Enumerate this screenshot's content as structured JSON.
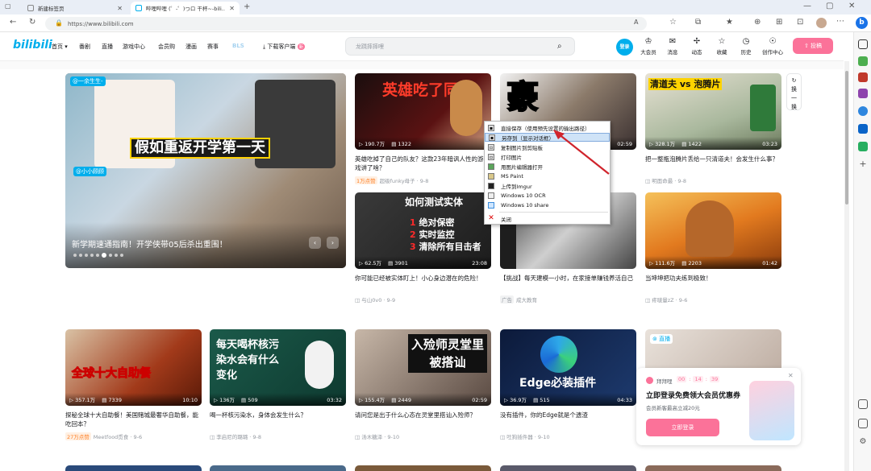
{
  "browser": {
    "tabs": [
      {
        "label": "新建标签页"
      },
      {
        "label": "哔哩哔哩 (゜-゜)つロ 干杯~-bili..."
      }
    ],
    "url": "https://www.bilibili.com"
  },
  "header": {
    "logo": "bilibili",
    "nav": [
      "首页",
      "番剧",
      "直播",
      "游戏中心",
      "会员购",
      "漫画",
      "赛事"
    ],
    "download": "下载客户端",
    "download_badge": "新",
    "search_placeholder": "龙跷摔摔哩",
    "login": "登录",
    "icons": [
      {
        "label": "大会员",
        "icon": "member-icon"
      },
      {
        "label": "消息",
        "icon": "message-icon"
      },
      {
        "label": "动态",
        "icon": "dynamic-icon"
      },
      {
        "label": "收藏",
        "icon": "star-icon"
      },
      {
        "label": "历史",
        "icon": "history-icon"
      },
      {
        "label": "创作中心",
        "icon": "creator-icon"
      }
    ],
    "upload": "投稿"
  },
  "banner": {
    "caption": "新学期速通指南！开学侠带05后杀出重围！",
    "overlay": "假如重返开学第一天",
    "tags": [
      "@一余生生-",
      "@小小顾顾"
    ]
  },
  "refresh": {
    "label": "换一换"
  },
  "videos": [
    {
      "overlay": "英雄吃了同伴",
      "views": "190.7万",
      "danmaku": "1322",
      "duration": "",
      "title": "英雄吃掉了自己的队友？这款23年暗讽人性的游戏讲了啥？",
      "tag": "1万点赞",
      "author": "超级funky母子",
      "date": "9-8"
    },
    {
      "overlay": "豪",
      "views": "",
      "danmaku": "",
      "duration": "02:59",
      "title": "",
      "tag": "",
      "author": "",
      "date": ""
    },
    {
      "overlay": "清道夫 vs 泡腾片",
      "views": "328.1万",
      "danmaku": "1422",
      "duration": "03:23",
      "title": "把一整瓶泡腾片丢给一只清道夫！会发生什么事？",
      "tag": "",
      "author": "明面命最",
      "date": "9-8"
    },
    {
      "overlay": "如何测试实体",
      "views": "62.5万",
      "danmaku": "3901",
      "duration": "23:08",
      "title": "你可能已经被实体盯上！小心身边潜在的危险！",
      "tag": "",
      "author": "与山0v0",
      "date": "9-9",
      "list": [
        "绝对保密",
        "实时监控",
        "清除所有目击者"
      ]
    },
    {
      "overlay": "",
      "views": "",
      "danmaku": "",
      "duration": "",
      "title": "【挑战】每天建模一小时，在家接单赚钱养活自己",
      "tag": "广告",
      "author": "成大教育",
      "date": ""
    },
    {
      "overlay": "",
      "views": "111.6万",
      "danmaku": "2203",
      "duration": "01:42",
      "title": "当坤坤把功夫练到极致！",
      "tag": "",
      "author": "疼啵量zZ",
      "date": "9-6"
    }
  ],
  "row2": [
    {
      "overlay": "全球十大自助餐",
      "views": "357.1万",
      "danmaku": "7339",
      "duration": "10:10",
      "title": "探秘全球十大自助餐！美国赌城最奢华自助餐，能吃回本？",
      "tag": "27万点赞",
      "author": "Meetfood觅食",
      "date": "9-6"
    },
    {
      "overlay": "每天喝杯核污染水会有什么变化",
      "views": "136万",
      "danmaku": "509",
      "duration": "03:32",
      "title": "喝一杯核污染水，身体会发生什么？",
      "tag": "",
      "author": "李启尼的璐璐",
      "date": "9-8"
    },
    {
      "overlay": "入殓师灵堂里被搭讪",
      "views": "155.4万",
      "danmaku": "2449",
      "duration": "02:59",
      "title": "请问您是出于什么心态在灵堂里搭讪入殓师？",
      "tag": "",
      "author": "汤木糖泽",
      "date": "9-10"
    },
    {
      "overlay": "Edge必装插件",
      "views": "36.9万",
      "danmaku": "515",
      "duration": "04:33",
      "title": "没有插件，你的Edge就是个遗渣",
      "tag": "",
      "author": "吐狗插件器",
      "date": "9-10"
    },
    {
      "overlay": "",
      "views": "",
      "danmaku": "",
      "duration": "",
      "title": "",
      "tag": "直播",
      "author": "",
      "date": ""
    }
  ],
  "context_menu": [
    {
      "label": "直接保存（使用预先设置的输出路径）"
    },
    {
      "label": "另存到（显示对话框）"
    },
    {
      "label": "复制图片到剪贴板"
    },
    {
      "label": "打印图片"
    },
    {
      "label": "用图片编辑器打开"
    },
    {
      "label": "MS Paint"
    },
    {
      "label": "上传到Imgur"
    },
    {
      "label": "Windows 10 OCR"
    },
    {
      "label": "Windows 10 share"
    },
    {
      "label": "关闭"
    }
  ],
  "promo": {
    "brand": "拜拜哩",
    "timer": [
      "00",
      "14",
      "39"
    ],
    "title": "立即登录免费领大会员优惠券",
    "subtitle": "会员新客最高立减20元",
    "button": "立即登录"
  }
}
